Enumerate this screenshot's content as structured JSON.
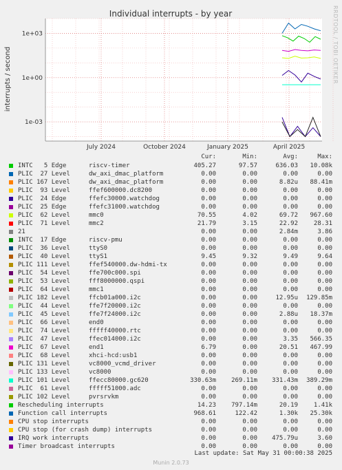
{
  "chart_data": {
    "type": "line",
    "title": "Individual interrupts - by year",
    "ylabel": "interrupts / second",
    "yscale": "log",
    "ylim": [
      5e-05,
      10000
    ],
    "yticks": [
      "1e+03",
      "1e+00",
      "1e-03"
    ],
    "xticks": [
      "July 2024",
      "October 2024",
      "January 2025",
      "April 2025"
    ],
    "grid": true,
    "series": [
      {
        "name": "INTC 5 Edge riscv-timer",
        "color": "#00cc00",
        "values": [
          700,
          500,
          300,
          650,
          450,
          250,
          600,
          400
        ]
      },
      {
        "name": "PLIC 62 Level mmc0",
        "color": "#cc00cc",
        "values": [
          70,
          60,
          80,
          70,
          65,
          75,
          70
        ]
      },
      {
        "name": "PLIC 71 Level mmc2",
        "color": "#ccff00",
        "values": [
          22,
          20,
          28,
          21,
          22,
          25,
          20
        ]
      },
      {
        "name": "PLIC 101 Level ffecc80000.gc620",
        "color": "#00ffcc",
        "values": [
          0.33,
          0.33,
          0.33,
          0.33
        ]
      },
      {
        "name": "Function call interrupts",
        "color": "#0066b3",
        "values": [
          1000,
          5000,
          2000,
          4000,
          3000,
          2000,
          1500
        ]
      },
      {
        "name": "Rescheduling interrupts",
        "color": "#330099",
        "values": [
          1.4,
          3,
          1.5,
          0.5,
          2,
          1.2,
          0.8
        ]
      },
      {
        "name": "IRQ work interrupts",
        "color": "#330099",
        "values": [
          0.002,
          0.0001,
          0.0005,
          0.0001,
          0.0004,
          0.0001
        ]
      },
      {
        "name": "PLIC 182 Level ffcb01a000.i2c",
        "color": "#222222",
        "values": [
          0.001,
          0.0001,
          0.0003,
          0.0001,
          0.002,
          0.0001
        ]
      }
    ]
  },
  "header": {
    "cur": "Cur:",
    "min": "Min:",
    "avg": "Avg:",
    "max": "Max:"
  },
  "legend": [
    {
      "label": "INTC   5 Edge      riscv-timer",
      "color": "#00cc00",
      "cur": "405.27",
      "min": "97.57",
      "avg": "636.03",
      "max": "10.08k"
    },
    {
      "label": "PLIC  27 Level     dw_axi_dmac_platform",
      "color": "#0066b3",
      "cur": "0.00",
      "min": "0.00",
      "avg": "0.00",
      "max": "0.00"
    },
    {
      "label": "PLIC 167 Level     dw_axi_dmac_platform",
      "color": "#ff8000",
      "cur": "0.00",
      "min": "0.00",
      "avg": "8.82u",
      "max": "88.41m"
    },
    {
      "label": "PLIC  93 Level     ffef600000.dc8200",
      "color": "#ffcc00",
      "cur": "0.00",
      "min": "0.00",
      "avg": "0.00",
      "max": "0.00"
    },
    {
      "label": "PLIC  24 Edge      ffefc30000.watchdog",
      "color": "#330099",
      "cur": "0.00",
      "min": "0.00",
      "avg": "0.00",
      "max": "0.00"
    },
    {
      "label": "PLIC  25 Edge      ffefc31000.watchdog",
      "color": "#990099",
      "cur": "0.00",
      "min": "0.00",
      "avg": "0.00",
      "max": "0.00"
    },
    {
      "label": "PLIC  62 Level     mmc0",
      "color": "#ccff00",
      "cur": "70.55",
      "min": "4.02",
      "avg": "69.72",
      "max": "967.60"
    },
    {
      "label": "PLIC  71 Level     mmc2",
      "color": "#ff0000",
      "cur": "21.79",
      "min": "3.15",
      "avg": "22.92",
      "max": "28.31"
    },
    {
      "label": "21",
      "color": "#808080",
      "cur": "0.00",
      "min": "0.00",
      "avg": "2.84m",
      "max": "3.86"
    },
    {
      "label": "INTC  17 Edge      riscv-pmu",
      "color": "#008f00",
      "cur": "0.00",
      "min": "0.00",
      "avg": "0.00",
      "max": "0.00"
    },
    {
      "label": "PLIC  36 Level     ttyS0",
      "color": "#00487d",
      "cur": "0.00",
      "min": "0.00",
      "avg": "0.00",
      "max": "0.00"
    },
    {
      "label": "PLIC  40 Level     ttyS1",
      "color": "#b35a00",
      "cur": "9.45",
      "min": "9.32",
      "avg": "9.49",
      "max": "9.64"
    },
    {
      "label": "PLIC 111 Level     ffef540000.dw-hdmi-tx",
      "color": "#b38f00",
      "cur": "0.00",
      "min": "0.00",
      "avg": "0.00",
      "max": "0.00"
    },
    {
      "label": "PLIC  54 Level     ffe700c000.spi",
      "color": "#6b006b",
      "cur": "0.00",
      "min": "0.00",
      "avg": "0.00",
      "max": "0.00"
    },
    {
      "label": "PLIC  53 Level     fff8000000.qspi",
      "color": "#8fb300",
      "cur": "0.00",
      "min": "0.00",
      "avg": "0.00",
      "max": "0.00"
    },
    {
      "label": "PLIC  64 Level     mmc1",
      "color": "#b30000",
      "cur": "0.00",
      "min": "0.00",
      "avg": "0.00",
      "max": "0.00"
    },
    {
      "label": "PLIC 182 Level     ffcb01a000.i2c",
      "color": "#bebebe",
      "cur": "0.00",
      "min": "0.00",
      "avg": "12.95u",
      "max": "129.85m"
    },
    {
      "label": "PLIC  44 Level     ffe7f20000.i2c",
      "color": "#80ff80",
      "cur": "0.00",
      "min": "0.00",
      "avg": "0.00",
      "max": "0.00"
    },
    {
      "label": "PLIC  45 Level     ffe7f24000.i2c",
      "color": "#80c9ff",
      "cur": "0.00",
      "min": "0.00",
      "avg": "2.88u",
      "max": "18.37m"
    },
    {
      "label": "PLIC  66 Level     end0",
      "color": "#ffc080",
      "cur": "0.00",
      "min": "0.00",
      "avg": "0.00",
      "max": "0.00"
    },
    {
      "label": "PLIC  74 Level     fffff40000.rtc",
      "color": "#ffe680",
      "cur": "0.00",
      "min": "0.00",
      "avg": "0.00",
      "max": "0.00"
    },
    {
      "label": "PLIC  47 Level     ffec014000.i2c",
      "color": "#aa80ff",
      "cur": "0.00",
      "min": "0.00",
      "avg": "3.35",
      "max": "566.35"
    },
    {
      "label": "PLIC  67 Level     end1",
      "color": "#ee00cc",
      "cur": "6.79",
      "min": "0.00",
      "avg": "20.51",
      "max": "467.99"
    },
    {
      "label": "PLIC  68 Level     xhci-hcd:usb1",
      "color": "#ff8080",
      "cur": "0.00",
      "min": "0.00",
      "avg": "0.00",
      "max": "0.00"
    },
    {
      "label": "PLIC 131 Level     vc8000_vcmd_driver",
      "color": "#666600",
      "cur": "0.00",
      "min": "0.00",
      "avg": "0.00",
      "max": "0.00"
    },
    {
      "label": "PLIC 133 Level     vc8000",
      "color": "#ffbfff",
      "cur": "0.00",
      "min": "0.00",
      "avg": "0.00",
      "max": "0.00"
    },
    {
      "label": "PLIC 101 Level     ffecc80000.gc620",
      "color": "#00ffcc",
      "cur": "330.63m",
      "min": "269.11m",
      "avg": "331.43m",
      "max": "389.29m"
    },
    {
      "label": "PLIC  61 Level     fffff51000.adc",
      "color": "#cc6699",
      "cur": "0.00",
      "min": "0.00",
      "avg": "0.00",
      "max": "0.00"
    },
    {
      "label": "PLIC 102 Level     pvrsrvkm",
      "color": "#999900",
      "cur": "0.00",
      "min": "0.00",
      "avg": "0.00",
      "max": "0.00"
    },
    {
      "label": "Rescheduling interrupts",
      "color": "#00cc00",
      "cur": "14.23",
      "min": "797.14m",
      "avg": "20.19",
      "max": "1.41k"
    },
    {
      "label": "Function call interrupts",
      "color": "#0066b3",
      "cur": "968.61",
      "min": "122.42",
      "avg": "1.30k",
      "max": "25.30k"
    },
    {
      "label": "CPU stop interrupts",
      "color": "#ff8000",
      "cur": "0.00",
      "min": "0.00",
      "avg": "0.00",
      "max": "0.00"
    },
    {
      "label": "CPU stop (for crash dump) interrupts",
      "color": "#ffcc00",
      "cur": "0.00",
      "min": "0.00",
      "avg": "0.00",
      "max": "0.00"
    },
    {
      "label": "IRQ work interrupts",
      "color": "#330099",
      "cur": "0.00",
      "min": "0.00",
      "avg": "475.79u",
      "max": "3.60"
    },
    {
      "label": "Timer broadcast interrupts",
      "color": "#990099",
      "cur": "0.00",
      "min": "0.00",
      "avg": "0.00",
      "max": "0.00"
    }
  ],
  "footer": {
    "last_update": "Last update: Sat May 31 00:00:38 2025",
    "generator": "Munin 2.0.73",
    "side_label": "RRDTOOL / TOBI OETIKER"
  }
}
